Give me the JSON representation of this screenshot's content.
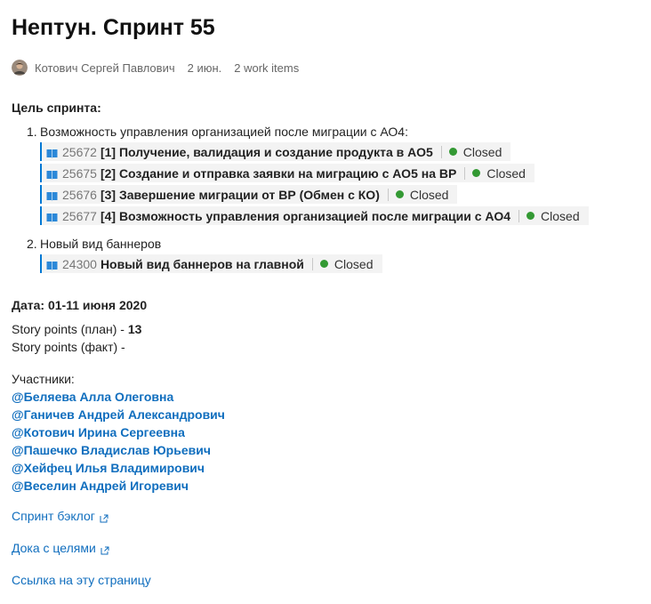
{
  "page": {
    "title": "Нептун. Спринт 55",
    "author": "Котович Сергей Павлович",
    "date": "2 июн.",
    "work_items_count": "2 work items"
  },
  "sprint_goal": {
    "heading": "Цель спринта:",
    "goals": [
      {
        "number": "1.",
        "text": "Возможность управления организацией после миграции с АО4:",
        "work_items": [
          {
            "id": "25672",
            "title": "[1] Получение, валидация и создание продукта в АО5",
            "state": "Closed",
            "icon": "book-icon"
          },
          {
            "id": "25675",
            "title": "[2] Создание и отправка заявки на миграцию с АО5 на ВР",
            "state": "Closed",
            "icon": "book-icon"
          },
          {
            "id": "25676",
            "title": "[3] Завершение миграции от ВР (Обмен с КО)",
            "state": "Closed",
            "icon": "book-icon"
          },
          {
            "id": "25677",
            "title": "[4] Возможность управления организацией после миграции с АО4",
            "state": "Closed",
            "icon": "book-icon"
          }
        ]
      },
      {
        "number": "2.",
        "text": "Новый вид баннеров",
        "work_items": [
          {
            "id": "24300",
            "title": "Новый вид баннеров на главной",
            "state": "Closed",
            "icon": "book-icon"
          }
        ]
      }
    ]
  },
  "facts": {
    "date_line": "Дата: 01-11 июня 2020",
    "sp_plan_label": "Story points (план) - ",
    "sp_plan_value": "13",
    "sp_fact_label": "Story points (факт) -"
  },
  "participants": {
    "heading": "Участники:",
    "list": [
      "@Беляева Алла Олеговна",
      "@Ганичев Андрей Александрович",
      "@Котович Ирина Сергеевна",
      "@Пашечко Владислав Юрьевич",
      "@Хейфец Илья Владимирович",
      "@Веселин Андрей Игоревич"
    ]
  },
  "links": {
    "backlog": "Спринт бэклог",
    "goals_doc": "Дока с целями",
    "page_link": "Ссылка на эту страницу"
  },
  "colors": {
    "link": "#106ebe",
    "pill_bg": "#f3f3f3",
    "pill_border": "#0078d4",
    "closed_state": "#339933",
    "muted_text": "#666666"
  }
}
